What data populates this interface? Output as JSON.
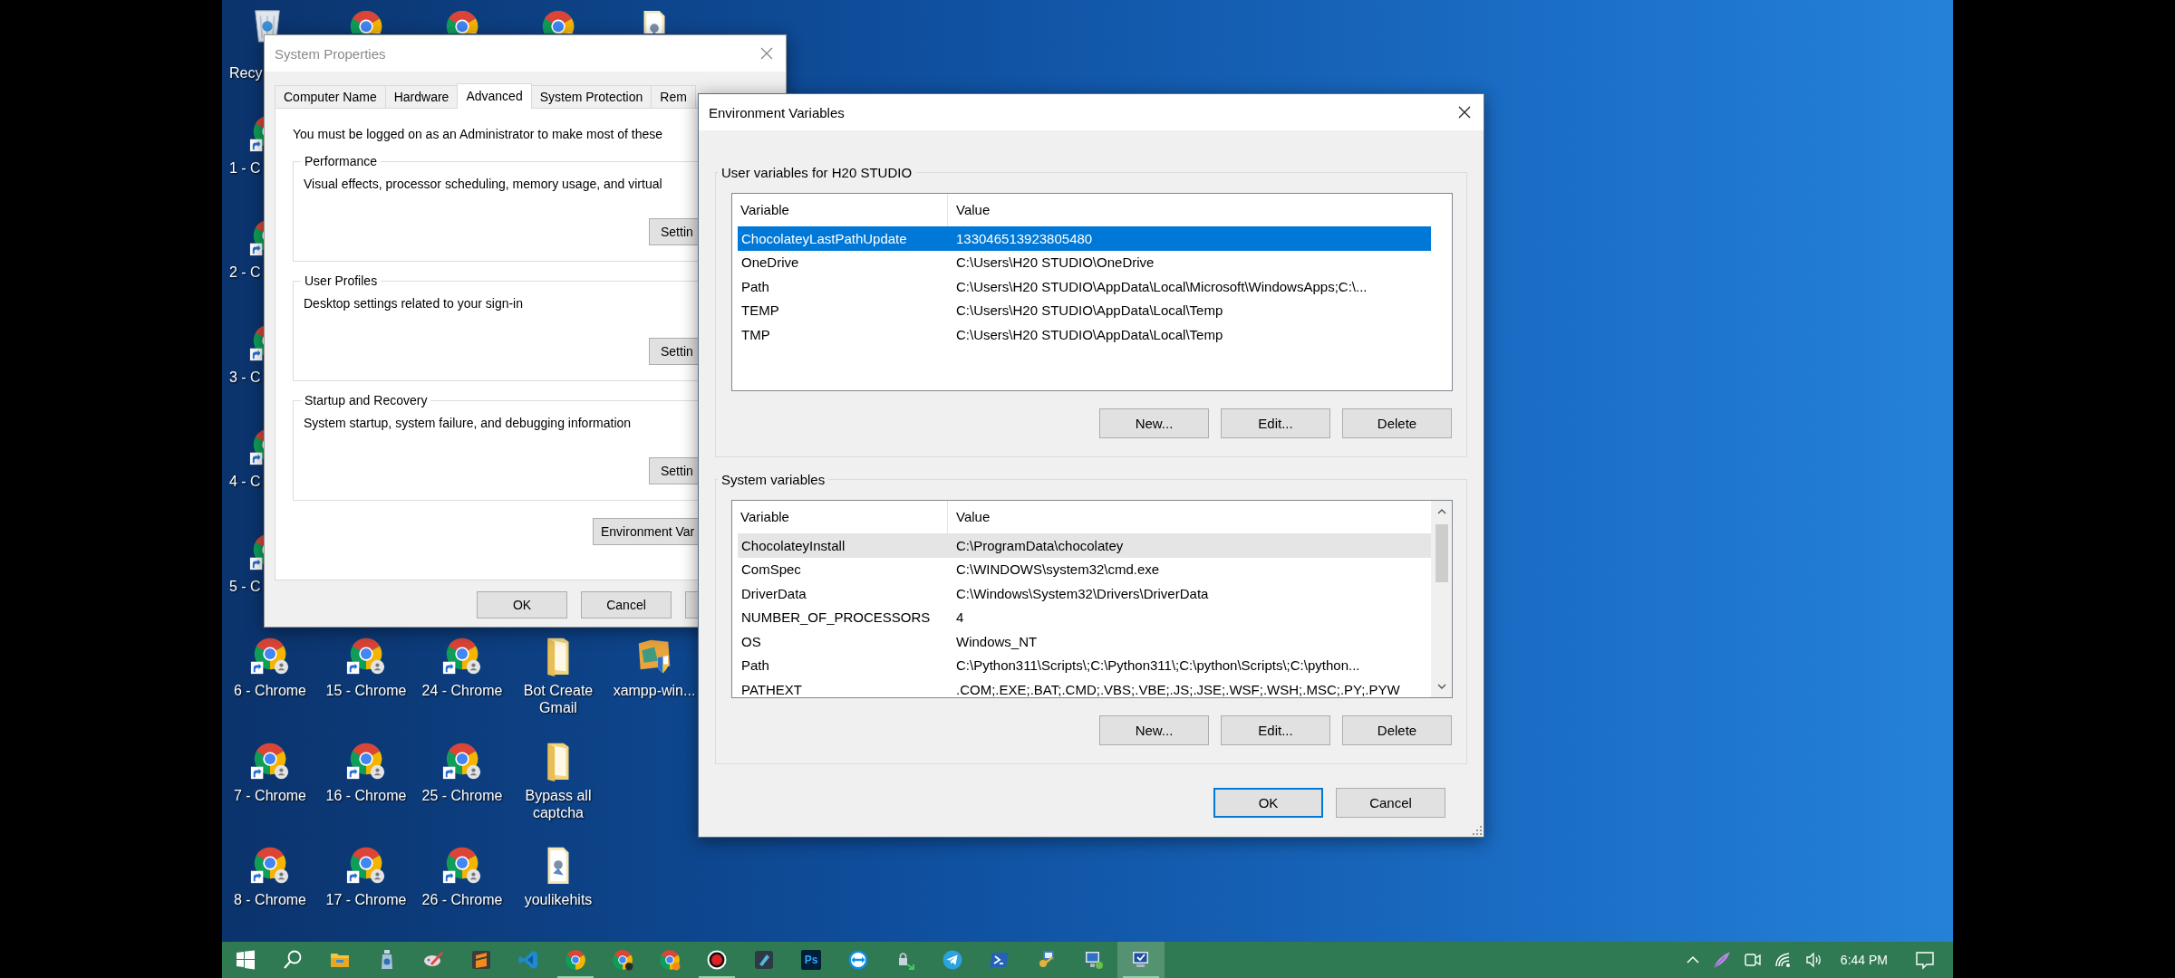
{
  "desktop": {
    "top_row": [
      {
        "kind": "recycle",
        "label": "Recy"
      },
      {
        "kind": "chrome"
      },
      {
        "kind": "chrome"
      },
      {
        "kind": "chrome"
      },
      {
        "kind": "file"
      }
    ],
    "left_column": [
      {
        "kind": "chrome",
        "label": "1 - C"
      },
      {
        "kind": "chrome",
        "label": "2 - C"
      },
      {
        "kind": "chrome",
        "label": "3 - C"
      },
      {
        "kind": "chrome",
        "label": "4 - C"
      },
      {
        "kind": "chrome",
        "label": "5 - C"
      }
    ],
    "rows": [
      [
        {
          "kind": "chrome",
          "label": "6 - Chrome"
        },
        {
          "kind": "chrome",
          "label": "15 - Chrome"
        },
        {
          "kind": "chrome",
          "label": "24 - Chrome"
        },
        {
          "kind": "folder",
          "label": "Bot Create Gmail"
        },
        {
          "kind": "installer",
          "label": "xampp-win..."
        }
      ],
      [
        {
          "kind": "chrome",
          "label": "7 - Chrome"
        },
        {
          "kind": "chrome",
          "label": "16 - Chrome"
        },
        {
          "kind": "chrome",
          "label": "25 - Chrome"
        },
        {
          "kind": "folder",
          "label": "Bypass all captcha"
        }
      ],
      [
        {
          "kind": "chrome",
          "label": "8 - Chrome"
        },
        {
          "kind": "chrome",
          "label": "17 - Chrome"
        },
        {
          "kind": "chrome",
          "label": "26 - Chrome"
        },
        {
          "kind": "file",
          "label": "youlikehits"
        }
      ]
    ]
  },
  "system_properties": {
    "title": "System Properties",
    "tabs": [
      {
        "label": "Computer Name",
        "selected": false
      },
      {
        "label": "Hardware",
        "selected": false
      },
      {
        "label": "Advanced",
        "selected": true
      },
      {
        "label": "System Protection",
        "selected": false
      },
      {
        "label": "Rem",
        "selected": false
      }
    ],
    "notice": "You must be logged on as an Administrator to make most of these",
    "groups": [
      {
        "title": "Performance",
        "description": "Visual effects, processor scheduling, memory usage, and virtual",
        "button": "Settin"
      },
      {
        "title": "User Profiles",
        "description": "Desktop settings related to your sign-in",
        "button": "Settin"
      },
      {
        "title": "Startup and Recovery",
        "description": "System startup, system failure, and debugging information",
        "button": "Settin"
      }
    ],
    "env_button": "Environment Var",
    "buttons": [
      "OK",
      "Cancel"
    ]
  },
  "environment_variables": {
    "title": "Environment Variables",
    "user_group": {
      "title": "User variables for H20 STUDIO",
      "columns": [
        "Variable",
        "Value"
      ],
      "rows": [
        {
          "variable": "ChocolateyLastPathUpdate",
          "value": "133046513923805480",
          "selected": true
        },
        {
          "variable": "OneDrive",
          "value": "C:\\Users\\H20 STUDIO\\OneDrive",
          "selected": false
        },
        {
          "variable": "Path",
          "value": "C:\\Users\\H20 STUDIO\\AppData\\Local\\Microsoft\\WindowsApps;C:\\...",
          "selected": false
        },
        {
          "variable": "TEMP",
          "value": "C:\\Users\\H20 STUDIO\\AppData\\Local\\Temp",
          "selected": false
        },
        {
          "variable": "TMP",
          "value": "C:\\Users\\H20 STUDIO\\AppData\\Local\\Temp",
          "selected": false
        }
      ],
      "buttons": [
        "New...",
        "Edit...",
        "Delete"
      ]
    },
    "system_group": {
      "title": "System variables",
      "columns": [
        "Variable",
        "Value"
      ],
      "rows": [
        {
          "variable": "ChocolateyInstall",
          "value": "C:\\ProgramData\\chocolatey",
          "highlighted": true
        },
        {
          "variable": "ComSpec",
          "value": "C:\\WINDOWS\\system32\\cmd.exe",
          "highlighted": false
        },
        {
          "variable": "DriverData",
          "value": "C:\\Windows\\System32\\Drivers\\DriverData",
          "highlighted": false
        },
        {
          "variable": "NUMBER_OF_PROCESSORS",
          "value": "4",
          "highlighted": false
        },
        {
          "variable": "OS",
          "value": "Windows_NT",
          "highlighted": false
        },
        {
          "variable": "Path",
          "value": "C:\\Python311\\Scripts\\;C:\\Python311\\;C:\\python\\Scripts\\;C:\\python...",
          "highlighted": false
        },
        {
          "variable": "PATHEXT",
          "value": ".COM;.EXE;.BAT;.CMD;.VBS;.VBE;.JS;.JSE;.WSF;.WSH;.MSC;.PY;.PYW",
          "highlighted": false
        }
      ],
      "buttons": [
        "New...",
        "Edit...",
        "Delete"
      ]
    },
    "buttons": [
      {
        "label": "OK",
        "default": true
      },
      {
        "label": "Cancel",
        "default": false
      }
    ]
  },
  "taskbar": {
    "apps": [
      {
        "kind": "start",
        "running": false,
        "active": false
      },
      {
        "kind": "search",
        "running": false,
        "active": false
      },
      {
        "kind": "folder",
        "running": false,
        "active": false
      },
      {
        "kind": "bottle",
        "running": false,
        "active": false
      },
      {
        "kind": "paint",
        "running": false,
        "active": false
      },
      {
        "kind": "sublime",
        "running": false,
        "active": false
      },
      {
        "kind": "vscode",
        "running": false,
        "active": false
      },
      {
        "kind": "chrome",
        "running": true,
        "active": false
      },
      {
        "kind": "chrome-dark-badge",
        "running": false,
        "active": false
      },
      {
        "kind": "chrome-orange-badge",
        "running": false,
        "active": false
      },
      {
        "kind": "recorder",
        "running": true,
        "active": false
      },
      {
        "kind": "dark-app",
        "running": false,
        "active": false
      },
      {
        "kind": "photoshop",
        "text": "Ps",
        "running": false,
        "active": false
      },
      {
        "kind": "teamviewer",
        "running": false,
        "active": false
      },
      {
        "kind": "lock-network",
        "running": false,
        "active": false
      },
      {
        "kind": "telegram",
        "running": false,
        "active": false
      },
      {
        "kind": "terminal",
        "running": false,
        "active": false
      },
      {
        "kind": "key-app",
        "running": false,
        "active": false
      },
      {
        "kind": "monitor",
        "running": false,
        "active": false
      },
      {
        "kind": "monitor-check",
        "running": true,
        "active": true
      }
    ],
    "clock": "6:44 PM"
  }
}
